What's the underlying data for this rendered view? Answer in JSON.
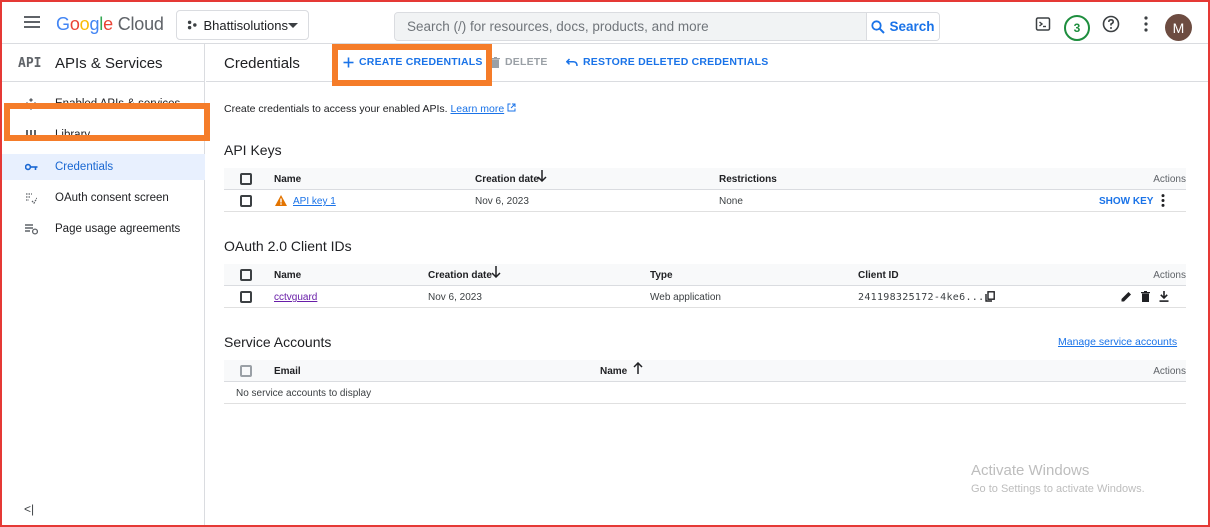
{
  "header": {
    "logo_google": "Google",
    "logo_cloud": "Cloud",
    "project_name": "Bhattisolutions",
    "search_placeholder": "Search (/) for resources, docs, products, and more",
    "search_button": "Search",
    "notification_count": "3",
    "avatar_initial": "M"
  },
  "sidebar": {
    "api_badge": "API",
    "title": "APIs & Services",
    "items": [
      {
        "label": "Enabled APIs & services",
        "icon": "enabled-apis-icon"
      },
      {
        "label": "Library",
        "icon": "library-icon"
      },
      {
        "label": "Credentials",
        "icon": "key-icon",
        "active": true
      },
      {
        "label": "OAuth consent screen",
        "icon": "consent-icon"
      },
      {
        "label": "Page usage agreements",
        "icon": "agreements-icon"
      }
    ],
    "collapse_label": "<|"
  },
  "toolbar": {
    "page_title": "Credentials",
    "create_label": "CREATE CREDENTIALS",
    "delete_label": "DELETE",
    "restore_label": "RESTORE DELETED CREDENTIALS"
  },
  "intro": {
    "text": "Create credentials to access your enabled APIs.",
    "learn_more": "Learn more"
  },
  "api_keys": {
    "title": "API Keys",
    "headers": {
      "name": "Name",
      "date": "Creation date",
      "restrictions": "Restrictions",
      "actions": "Actions"
    },
    "rows": [
      {
        "name": "API key 1",
        "date": "Nov 6, 2023",
        "restrictions": "None",
        "action": "SHOW KEY"
      }
    ]
  },
  "oauth": {
    "title": "OAuth 2.0 Client IDs",
    "headers": {
      "name": "Name",
      "date": "Creation date",
      "type": "Type",
      "client_id": "Client ID",
      "actions": "Actions"
    },
    "rows": [
      {
        "name": "cctvguard",
        "date": "Nov 6, 2023",
        "type": "Web application",
        "client_id": "241198325172-4ke6..."
      }
    ]
  },
  "service_accounts": {
    "title": "Service Accounts",
    "manage_link": "Manage service accounts",
    "headers": {
      "email": "Email",
      "name": "Name",
      "actions": "Actions"
    },
    "empty_text": "No service accounts to display"
  },
  "watermark": {
    "line1": "Activate Windows",
    "line2": "Go to Settings to activate Windows."
  },
  "colors": {
    "accent": "#1a73e8",
    "highlight": "#f57c29",
    "frame": "#e53935"
  }
}
